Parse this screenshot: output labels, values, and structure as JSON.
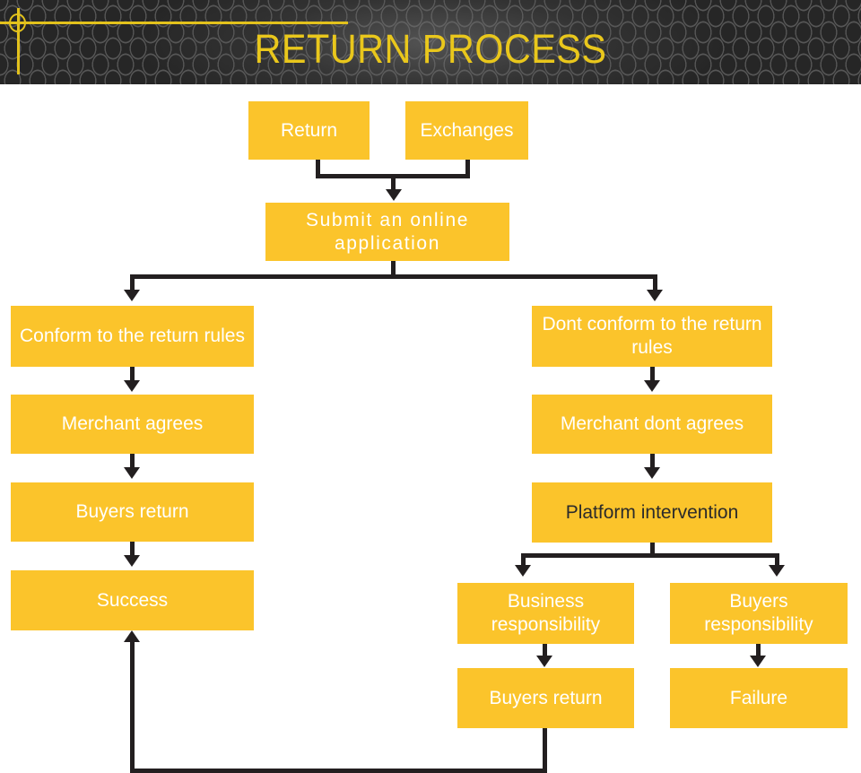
{
  "header": {
    "title": "RETURN PROCESS",
    "accent_color": "#e9c71c",
    "background_color": "#474747",
    "decor": {
      "circle": "decorative-circle",
      "horizontal_rule": "decorative-horizontal-line",
      "vertical_rule": "decorative-vertical-line"
    }
  },
  "theme": {
    "node_fill": "#fbc42b",
    "node_text": "#ffffff",
    "node_text_dark": "#2b2b2b",
    "connector": "#231f20",
    "page_background": "#ffffff"
  },
  "flowchart": {
    "nodes": [
      {
        "id": "return",
        "label": "Return"
      },
      {
        "id": "exchanges",
        "label": "Exchanges"
      },
      {
        "id": "submit-application",
        "label": "Submit an online application"
      },
      {
        "id": "conform",
        "label": "Conform to the return rules"
      },
      {
        "id": "merchant-agrees",
        "label": "Merchant agrees"
      },
      {
        "id": "buyers-return-left",
        "label": "Buyers return"
      },
      {
        "id": "success",
        "label": "Success"
      },
      {
        "id": "dont-conform",
        "label": "Dont conform to the return rules"
      },
      {
        "id": "merchant-dont-agrees",
        "label": "Merchant dont agrees"
      },
      {
        "id": "platform-intervention",
        "label": "Platform intervention"
      },
      {
        "id": "business-responsibility",
        "label": "Business responsibility"
      },
      {
        "id": "buyers-responsibility",
        "label": "Buyers responsibility"
      },
      {
        "id": "buyers-return-bottom",
        "label": "Buyers return"
      },
      {
        "id": "failure",
        "label": "Failure"
      }
    ],
    "edges": [
      {
        "from": "return",
        "to": "submit-application"
      },
      {
        "from": "exchanges",
        "to": "submit-application"
      },
      {
        "from": "submit-application",
        "to": "conform"
      },
      {
        "from": "submit-application",
        "to": "dont-conform"
      },
      {
        "from": "conform",
        "to": "merchant-agrees"
      },
      {
        "from": "merchant-agrees",
        "to": "buyers-return-left"
      },
      {
        "from": "buyers-return-left",
        "to": "success"
      },
      {
        "from": "dont-conform",
        "to": "merchant-dont-agrees"
      },
      {
        "from": "merchant-dont-agrees",
        "to": "platform-intervention"
      },
      {
        "from": "platform-intervention",
        "to": "business-responsibility"
      },
      {
        "from": "platform-intervention",
        "to": "buyers-responsibility"
      },
      {
        "from": "business-responsibility",
        "to": "buyers-return-bottom"
      },
      {
        "from": "buyers-responsibility",
        "to": "failure"
      },
      {
        "from": "buyers-return-bottom",
        "to": "success"
      }
    ]
  }
}
